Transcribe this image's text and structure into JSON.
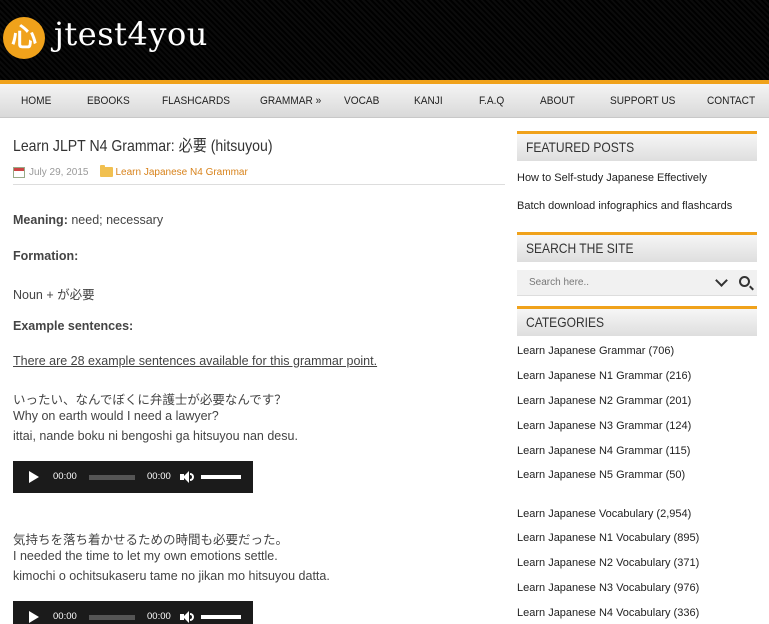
{
  "brand": {
    "logo_char": "心",
    "name": "jtest4you"
  },
  "nav": [
    "HOME",
    "EBOOKS",
    "FLASHCARDS",
    "GRAMMAR »",
    "VOCAB",
    "KANJI",
    "F.A.Q",
    "ABOUT",
    "SUPPORT US",
    "CONTACT"
  ],
  "post": {
    "title": "Learn JLPT N4 Grammar: 必要 (hitsuyou)",
    "date": "July 29, 2015",
    "category": "Learn Japanese N4 Grammar",
    "meaning_label": "Meaning:",
    "meaning_value": "need; necessary",
    "formation_label": "Formation:",
    "formation_value": "Noun + が必要",
    "examples_label": "Example sentences:",
    "examples_link": "There are 28 example sentences available for this grammar point.",
    "examples": [
      {
        "jp": "いったい、なんでぼくに弁護士が必要なんです？",
        "en": "Why on earth would I need a lawyer?",
        "romaji": "ittai, nande boku ni bengoshi ga hitsuyou nan desu."
      },
      {
        "jp": "気持ちを落ち着かせるための時間も必要だった。",
        "en": "I needed the time to let my own emotions settle.",
        "romaji": "kimochi o ochitsukaseru tame no jikan mo hitsuyou datta."
      }
    ],
    "audio_time": "00:00"
  },
  "sidebar": {
    "featured_title": "FEATURED POSTS",
    "featured": [
      "How to Self-study Japanese Effectively",
      "Batch download infographics and flashcards"
    ],
    "search_title": "SEARCH THE SITE",
    "search_placeholder": "Search here..",
    "categories_title": "CATEGORIES",
    "categories": [
      "Learn Japanese Grammar (706)",
      "Learn Japanese N1 Grammar (216)",
      "Learn Japanese N2 Grammar (201)",
      "Learn Japanese N3 Grammar (124)",
      "Learn Japanese N4 Grammar (115)",
      "Learn Japanese N5 Grammar (50)",
      "Learn Japanese Vocabulary (2,954)",
      "Learn Japanese N1 Vocabulary (895)",
      "Learn Japanese N2 Vocabulary (371)",
      "Learn Japanese N3 Vocabulary (976)",
      "Learn Japanese N4 Vocabulary (336)"
    ]
  },
  "colors": {
    "accent": "#f0a21b",
    "header_bg": "#000000",
    "category_link": "#d8831c"
  }
}
